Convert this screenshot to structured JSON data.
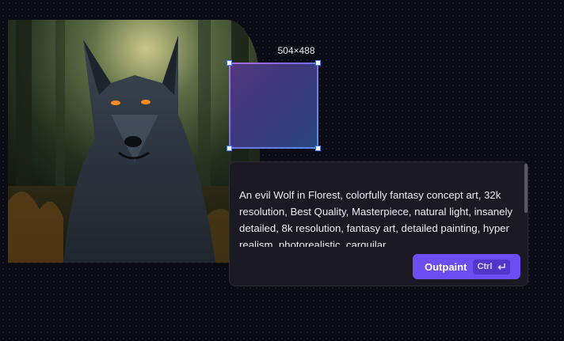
{
  "canvas": {
    "image_subject": "wolf-in-forest",
    "selection": {
      "size_label": "504×488"
    }
  },
  "prompt_panel": {
    "text": "An evil Wolf in Florest, colorfully fantasy concept art, 32k resolution, Best Quality, Masterpiece, natural light, insanely detailed, 8k resolution, fantasy art, detailed painting, hyper realism, photorealistic, carguilar,",
    "button": {
      "label": "Outpaint",
      "shortcut_key": "Ctrl",
      "shortcut_icon": "enter-icon"
    }
  },
  "colors": {
    "background": "#0b0b15",
    "panel": "#1b1a24",
    "accent": "#6c4df2",
    "frame_gradient_start": "#a86cf6",
    "frame_gradient_end": "#4f8ef5"
  }
}
